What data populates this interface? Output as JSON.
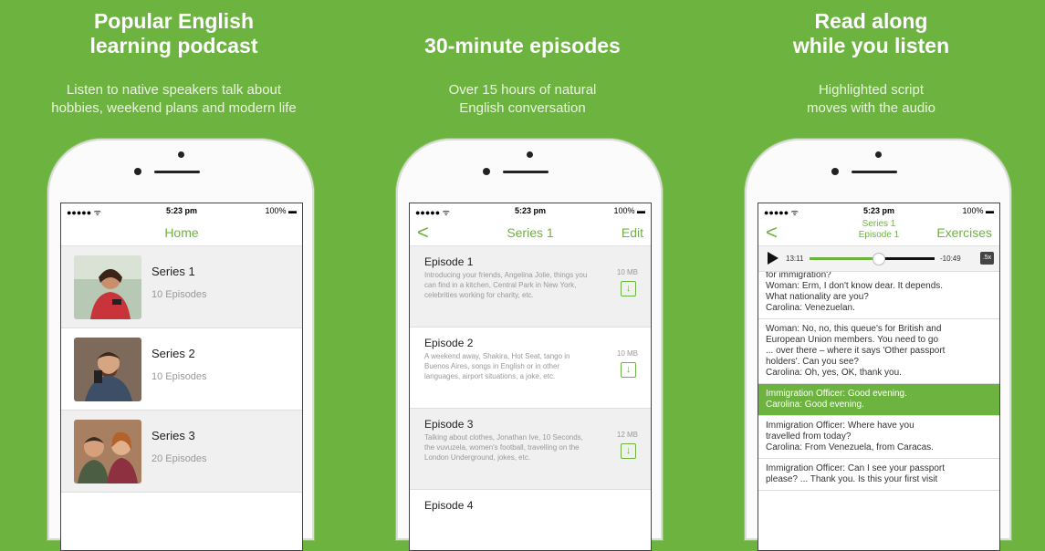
{
  "panels": [
    {
      "title_lines": [
        "Popular English",
        "learning podcast"
      ],
      "subtitle_lines": [
        "Listen to native speakers talk about",
        "hobbies, weekend plans and modern life"
      ]
    },
    {
      "title_lines": [
        "30-minute episodes"
      ],
      "subtitle_lines": [
        "Over 15 hours of natural",
        "English conversation"
      ]
    },
    {
      "title_lines": [
        "Read along",
        "while you listen"
      ],
      "subtitle_lines": [
        "Highlighted script",
        "moves with the audio"
      ]
    }
  ],
  "status": {
    "signal": "●●●●● ᯤ",
    "time": "5:23 pm",
    "battery": "100% ▬"
  },
  "home": {
    "title": "Home",
    "series": [
      {
        "name": "Series 1",
        "count": "10 Episodes"
      },
      {
        "name": "Series 2",
        "count": "10 Episodes"
      },
      {
        "name": "Series 3",
        "count": "20 Episodes"
      }
    ]
  },
  "episodes_screen": {
    "back": "<",
    "title": "Series 1",
    "edit": "Edit",
    "episodes": [
      {
        "name": "Episode 1",
        "size": "10 MB",
        "desc": "Introducing your friends, Angelina Jolie, things you can find in a kitchen, Central Park in New York, celebrities working for charity, etc."
      },
      {
        "name": "Episode 2",
        "size": "10 MB",
        "desc": "A weekend away, Shakira, Hot Seat, tango in Buenos Aires, songs in English or in other languages, airport situations, a joke, etc."
      },
      {
        "name": "Episode 3",
        "size": "12 MB",
        "desc": "Talking about clothes, Jonathan Ive, 10 Seconds, the vuvuzela, women's football, travelling on the London Underground, jokes, etc."
      },
      {
        "name": "Episode 4",
        "size": "",
        "desc": ""
      }
    ]
  },
  "script_screen": {
    "back": "<",
    "title_line1": "Series 1",
    "title_line2": "Episode 1",
    "exercises": "Exercises",
    "player": {
      "elapsed": "13:11",
      "remaining": "-10:49",
      "speed": ".5x",
      "progress": 0.55
    },
    "blocks": [
      {
        "lines": [
          "for immigration?",
          "Woman: Erm, I don't know dear. It depends.",
          "What nationality are you?",
          "Carolina: Venezuelan."
        ]
      },
      {
        "lines": [
          "Woman: No, no, this queue's for British and",
          "European Union members. You need to go",
          "... over there – where it says 'Other passport",
          "holders'. Can you see?",
          "Carolina: Oh, yes, OK, thank you."
        ]
      },
      {
        "lines": [
          "Immigration Officer: Good evening.",
          "Carolina: Good evening."
        ]
      },
      {
        "lines": [
          "Immigration Officer: Where have you",
          "travelled from today?",
          "Carolina: From Venezuela, from Caracas."
        ]
      },
      {
        "lines": [
          "Immigration Officer: Can I see your passport",
          "please? ... Thank you. Is this your first visit"
        ]
      }
    ]
  },
  "colors": {
    "brand_green": "#6db33f",
    "background": "#6db33f"
  }
}
